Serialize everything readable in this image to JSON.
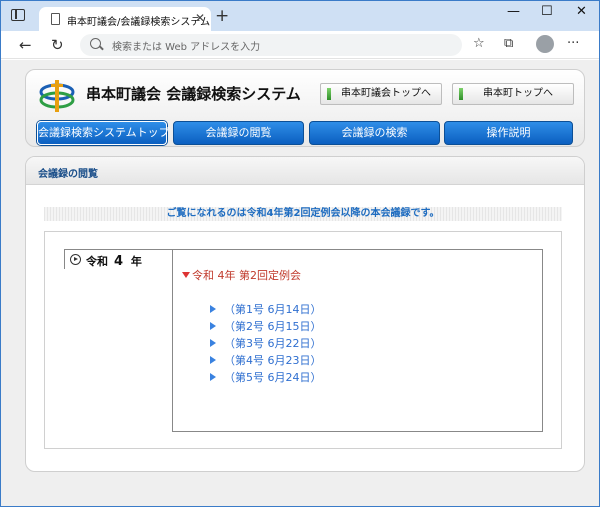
{
  "browser": {
    "tab_title": "串本町議会/会議録検索システム",
    "tab_close": "✕",
    "new_tab": "+",
    "address_placeholder": "検索または Web アドレスを入力",
    "window_controls": [
      "—",
      "☐",
      "✕"
    ],
    "icons": {
      "back": "back-arrow-icon",
      "refresh": "refresh-icon",
      "favorites": "favorites-icon",
      "collections": "collections-icon",
      "profile": "profile-icon",
      "menu": "more-menu-icon"
    }
  },
  "site": {
    "title": "串本町議会 会議録検索システム",
    "top_links": [
      "串本町議会トップへ",
      "串本町トップへ"
    ],
    "nav": [
      "会議録検索システムトップ",
      "会議録の閲覧",
      "会議録の検索",
      "操作説明"
    ]
  },
  "panel": {
    "title": "会議録の閲覧",
    "notice": "ご覧になれるのは令和4年第2回定例会以降の本会議録です。",
    "year_era": "令和",
    "year_num": "4",
    "year_suffix": "年",
    "session": "令和 4年 第2回定例会",
    "issues": [
      "（第1号 6月14日）",
      "（第2号 6月15日）",
      "（第3号 6月22日）",
      "（第4号 6月23日）",
      "（第5号 6月24日）"
    ]
  },
  "colors": {
    "nav_blue": "#0b5fc0",
    "link_blue": "#2f6fd0",
    "session_red": "#c0392b"
  }
}
